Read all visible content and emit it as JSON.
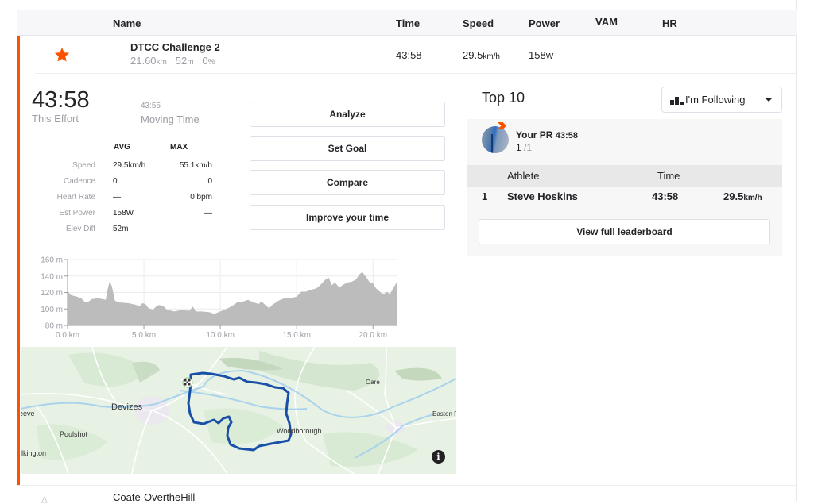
{
  "colors": {
    "accent": "#fc5200",
    "route": "#1a4fa8",
    "elevation_fill": "#bcbcbc"
  },
  "table": {
    "headers": {
      "name": "Name",
      "time": "Time",
      "speed": "Speed",
      "power": "Power",
      "vam": "VAM",
      "hr": "HR"
    },
    "rows": [
      {
        "icon": "star-icon",
        "name": "DTCC Challenge 2",
        "distance": "21.60",
        "distance_unit": "km",
        "elev": "52",
        "elev_unit": "m",
        "grade": "0",
        "grade_unit": "%",
        "time": "43:58",
        "speed": "29.5",
        "speed_unit": "km/h",
        "power": "158",
        "power_unit": "W",
        "vam": "",
        "hr": "—"
      },
      {
        "icon": "segment-icon",
        "name": "Coate-OvertheHill"
      }
    ]
  },
  "effort": {
    "time": "43:58",
    "time_label": "This Effort",
    "moving_time": "43:55",
    "moving_label": "Moving Time",
    "avg_header": "AVG",
    "max_header": "MAX",
    "stats": [
      {
        "label": "Speed",
        "avg": "29.5km/h",
        "max": "55.1km/h"
      },
      {
        "label": "Cadence",
        "avg": "0",
        "max": "0"
      },
      {
        "label": "Heart Rate",
        "avg": "—",
        "max": "0 bpm"
      },
      {
        "label": "Est Power",
        "avg": "158W",
        "max": "—"
      },
      {
        "label": "Elev Diff",
        "avg": "52m",
        "max": ""
      }
    ]
  },
  "actions": {
    "analyze": "Analyze",
    "set_goal": "Set Goal",
    "compare": "Compare",
    "improve": "Improve your time"
  },
  "leaderboard": {
    "title": "Top 10",
    "filter": "I'm Following",
    "pr_label": "Your PR",
    "pr_time": "43:58",
    "pr_rank": "1",
    "pr_total": "/1",
    "col_athlete": "Athlete",
    "col_time": "Time",
    "entries": [
      {
        "rank": "1",
        "athlete": "Steve Hoskins",
        "time": "43:58",
        "speed": "29.5",
        "speed_unit": "km/h"
      }
    ],
    "view_full": "View full leaderboard"
  },
  "elevation": {
    "y_ticks": [
      "160 m",
      "140 m",
      "120 m",
      "100 m",
      "80 m"
    ],
    "x_ticks": [
      "0.0 km",
      "5.0 km",
      "10.0 km",
      "15.0 km",
      "20.0 km"
    ],
    "y_range_m": [
      80,
      160
    ],
    "x_range_km": [
      0,
      21.6
    ],
    "profile_km_m": [
      [
        0,
        122
      ],
      [
        0.2,
        117
      ],
      [
        0.6,
        115
      ],
      [
        0.9,
        113
      ],
      [
        1.1,
        109
      ],
      [
        1.3,
        108
      ],
      [
        1.6,
        112
      ],
      [
        2.0,
        113
      ],
      [
        2.3,
        112
      ],
      [
        2.5,
        111
      ],
      [
        2.6,
        122
      ],
      [
        2.75,
        133
      ],
      [
        2.9,
        128
      ],
      [
        3.1,
        110
      ],
      [
        3.4,
        108
      ],
      [
        4.0,
        107
      ],
      [
        4.5,
        105
      ],
      [
        4.7,
        103
      ],
      [
        4.9,
        107
      ],
      [
        5.1,
        106
      ],
      [
        5.3,
        101
      ],
      [
        5.6,
        99
      ],
      [
        5.8,
        103
      ],
      [
        6.0,
        105
      ],
      [
        6.3,
        103
      ],
      [
        6.5,
        99
      ],
      [
        7.0,
        97
      ],
      [
        7.5,
        99
      ],
      [
        7.8,
        98
      ],
      [
        8.0,
        98
      ],
      [
        8.2,
        103
      ],
      [
        8.4,
        97
      ],
      [
        8.8,
        97
      ],
      [
        9.3,
        96
      ],
      [
        9.6,
        94
      ],
      [
        10.0,
        97
      ],
      [
        10.4,
        100
      ],
      [
        10.8,
        104
      ],
      [
        11.1,
        108
      ],
      [
        11.5,
        109
      ],
      [
        11.8,
        111
      ],
      [
        12.2,
        108
      ],
      [
        12.5,
        106
      ],
      [
        12.7,
        109
      ],
      [
        13.0,
        104
      ],
      [
        13.2,
        101
      ],
      [
        13.4,
        105
      ],
      [
        13.8,
        110
      ],
      [
        14.2,
        113
      ],
      [
        14.6,
        113
      ],
      [
        15.0,
        115
      ],
      [
        15.3,
        121
      ],
      [
        15.6,
        121
      ],
      [
        15.9,
        123
      ],
      [
        16.3,
        125
      ],
      [
        16.6,
        130
      ],
      [
        16.9,
        136
      ],
      [
        17.1,
        138
      ],
      [
        17.3,
        129
      ],
      [
        17.5,
        132
      ],
      [
        17.8,
        126
      ],
      [
        18.0,
        129
      ],
      [
        18.3,
        132
      ],
      [
        18.6,
        133
      ],
      [
        18.9,
        136
      ],
      [
        19.1,
        142
      ],
      [
        19.3,
        145
      ],
      [
        19.5,
        140
      ],
      [
        19.8,
        132
      ],
      [
        20.0,
        131
      ],
      [
        20.2,
        125
      ],
      [
        20.5,
        120
      ],
      [
        20.7,
        118
      ],
      [
        20.9,
        121
      ],
      [
        21.1,
        118
      ],
      [
        21.3,
        124
      ],
      [
        21.5,
        131
      ],
      [
        21.6,
        134
      ]
    ]
  },
  "map": {
    "labels": [
      "Devizes",
      "Poulshot",
      "ulkington",
      "eeve",
      "Woodborough",
      "Oare",
      "Easton R"
    ],
    "info": "i"
  }
}
